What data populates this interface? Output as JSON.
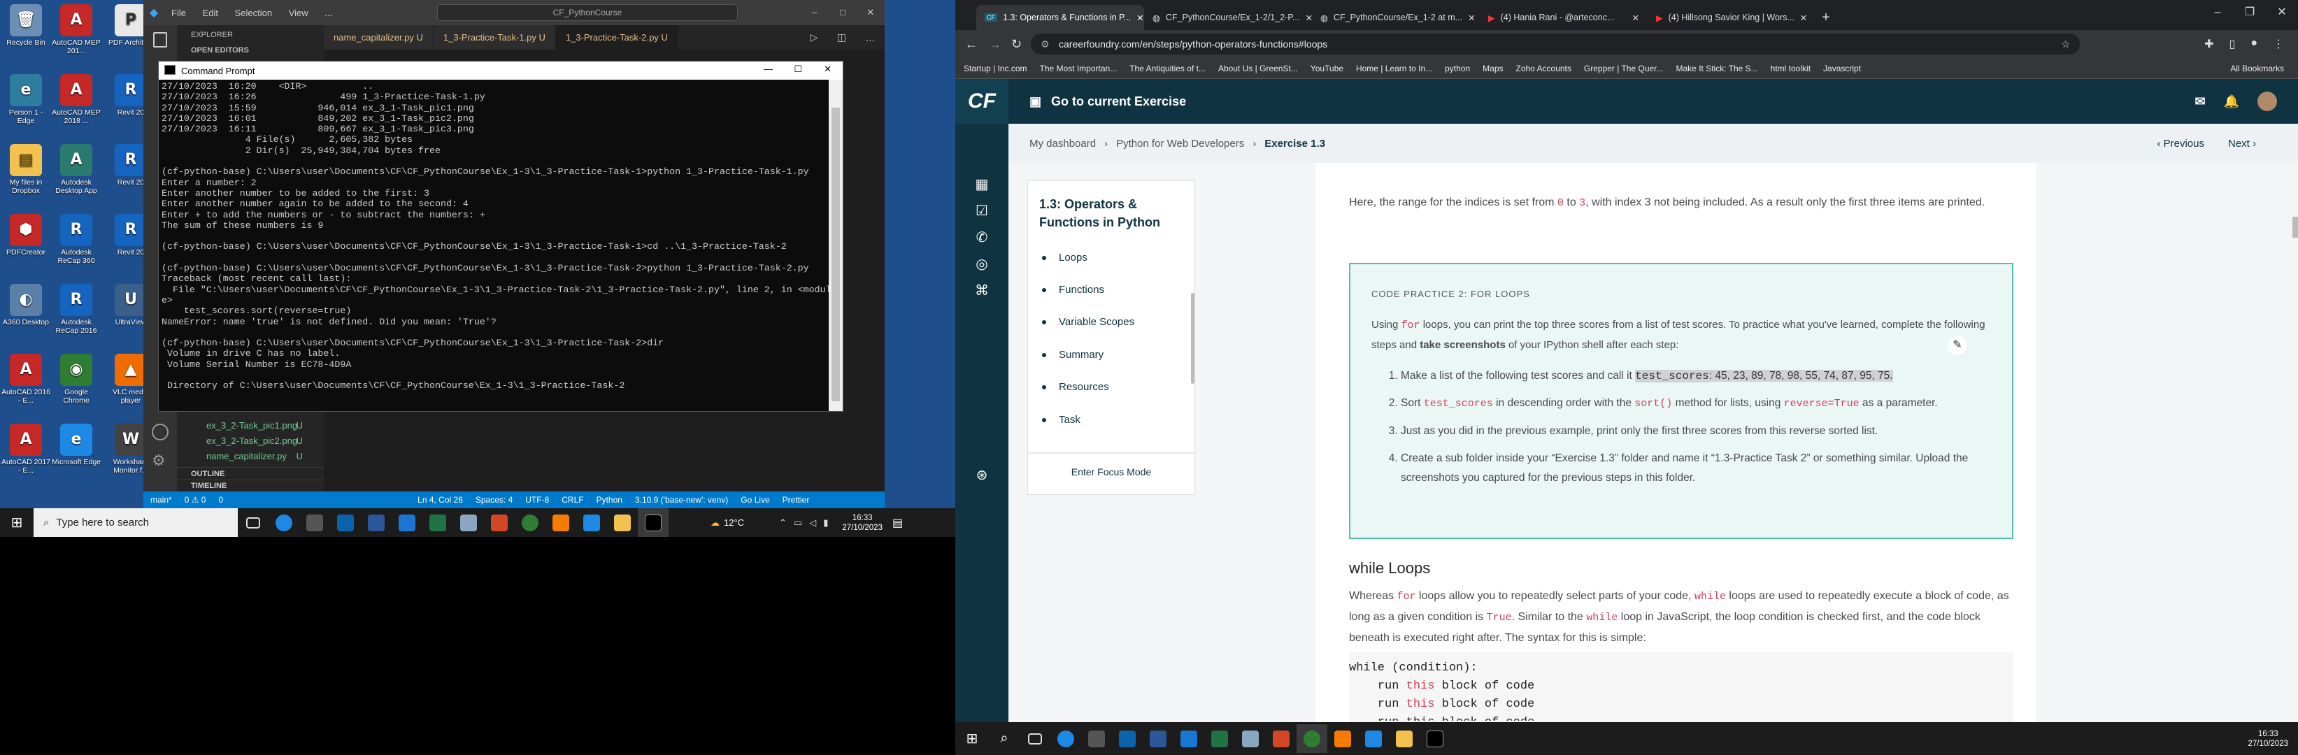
{
  "desktop": {
    "icons": [
      {
        "label": "Recycle Bin",
        "color": "#6d8fb5",
        "glyph": "🗑"
      },
      {
        "label": "AutoCAD MEP 201...",
        "color": "#c62828",
        "glyph": "A"
      },
      {
        "label": "PDF Architect",
        "color": "#e8e8e8",
        "glyph": "P"
      },
      {
        "label": "Person 1 - Edge",
        "color": "#2e7d9e",
        "glyph": "e"
      },
      {
        "label": "AutoCAD MEP 2018 ...",
        "color": "#c62828",
        "glyph": "A"
      },
      {
        "label": "Revit 20",
        "color": "#1565c0",
        "glyph": "R"
      },
      {
        "label": "My files in Dropbox",
        "color": "#f2c14e",
        "glyph": "▤"
      },
      {
        "label": "Autodesk Desktop App",
        "color": "#2a7a6e",
        "glyph": "A"
      },
      {
        "label": "Revit 20",
        "color": "#1565c0",
        "glyph": "R"
      },
      {
        "label": "PDFCreator",
        "color": "#c62828",
        "glyph": "⬢"
      },
      {
        "label": "Autodesk ReCap 360",
        "color": "#1565c0",
        "glyph": "R"
      },
      {
        "label": "Revit 20",
        "color": "#1565c0",
        "glyph": "R"
      },
      {
        "label": "A360 Desktop",
        "color": "#5a7fa8",
        "glyph": "◐"
      },
      {
        "label": "Autodesk ReCap 2016",
        "color": "#1565c0",
        "glyph": "R"
      },
      {
        "label": "UltraView",
        "color": "#3a5f8a",
        "glyph": "U"
      },
      {
        "label": "AutoCAD 2016 - E...",
        "color": "#c62828",
        "glyph": "A"
      },
      {
        "label": "Google Chrome",
        "color": "#2e7d32",
        "glyph": "◉"
      },
      {
        "label": "VLC media player",
        "color": "#ef6c00",
        "glyph": "▲"
      },
      {
        "label": "AutoCAD 2017 - E...",
        "color": "#c62828",
        "glyph": "A"
      },
      {
        "label": "Microsoft Edge",
        "color": "#1e88e5",
        "glyph": "e"
      },
      {
        "label": "Workshare Monitor f...",
        "color": "#424242",
        "glyph": "W"
      }
    ]
  },
  "vscode": {
    "menu": [
      "File",
      "Edit",
      "Selection",
      "View",
      "..."
    ],
    "search": "CF_PythonCourse",
    "tabs": [
      {
        "label": "name_capitalizer.py  U"
      },
      {
        "label": "1_3-Practice-Task-1.py  U"
      },
      {
        "label": "1_3-Practice-Task-2.py  U"
      }
    ],
    "sidebar_title": "EXPLORER",
    "sidebar_sub": "OPEN EDITORS",
    "files": [
      {
        "name": "ex_3_2-Task_pic1.png",
        "status": "U"
      },
      {
        "name": "ex_3_2-Task_pic2.png",
        "status": "U"
      },
      {
        "name": "name_capitalizer.py",
        "status": "U"
      }
    ],
    "sections": [
      "OUTLINE",
      "TIMELINE"
    ],
    "status": {
      "branch": "main*",
      "errors": "0 ⚠ 0",
      "ports": "0",
      "position": "Ln 4, Col 26",
      "spaces": "Spaces: 4",
      "encoding": "UTF-8",
      "eol": "CRLF",
      "language": "Python",
      "interpreter": "3.10.9 ('base-new': venv)",
      "golive": "Go Live",
      "prettier": "Prettier"
    }
  },
  "cmd": {
    "title": "Command Prompt",
    "lines": [
      "27/10/2023  16:20    <DIR>          ..",
      "27/10/2023  16:26               499 1_3-Practice-Task-1.py",
      "27/10/2023  15:59           946,014 ex_3_1-Task_pic1.png",
      "27/10/2023  16:01           849,202 ex_3_1-Task_pic2.png",
      "27/10/2023  16:11           809,667 ex_3_1-Task_pic3.png",
      "               4 File(s)      2,605,382 bytes",
      "               2 Dir(s)  25,949,384,704 bytes free",
      "",
      "(cf-python-base) C:\\Users\\user\\Documents\\CF\\CF_PythonCourse\\Ex_1-3\\1_3-Practice-Task-1>python 1_3-Practice-Task-1.py",
      "Enter a number: 2",
      "Enter another number to be added to the first: 3",
      "Enter another number again to be added to the second: 4",
      "Enter + to add the numbers or - to subtract the numbers: +",
      "The sum of these numbers is 9",
      "",
      "(cf-python-base) C:\\Users\\user\\Documents\\CF\\CF_PythonCourse\\Ex_1-3\\1_3-Practice-Task-1>cd ..\\1_3-Practice-Task-2",
      "",
      "(cf-python-base) C:\\Users\\user\\Documents\\CF\\CF_PythonCourse\\Ex_1-3\\1_3-Practice-Task-2>python 1_3-Practice-Task-2.py",
      "Traceback (most recent call last):",
      "  File \"C:\\Users\\user\\Documents\\CF\\CF_PythonCourse\\Ex_1-3\\1_3-Practice-Task-2\\1_3-Practice-Task-2.py\", line 2, in <modul",
      "e>",
      "    test_scores.sort(reverse=true)",
      "NameError: name 'true' is not defined. Did you mean: 'True'?",
      "",
      "(cf-python-base) C:\\Users\\user\\Documents\\CF\\CF_PythonCourse\\Ex_1-3\\1_3-Practice-Task-2>dir",
      " Volume in drive C has no label.",
      " Volume Serial Number is EC78-4D9A",
      "",
      " Directory of C:\\Users\\user\\Documents\\CF\\CF_PythonCourse\\Ex_1-3\\1_3-Practice-Task-2"
    ]
  },
  "taskbar_left": {
    "search_placeholder": "Type here to search",
    "weather": "12°C",
    "time": "16:33",
    "date": "27/10/2023"
  },
  "chrome": {
    "tabs": [
      {
        "label": "1.3: Operators & Functions in P...",
        "icon": "CF"
      },
      {
        "label": "CF_PythonCourse/Ex_1-2/1_2-P...",
        "icon": "gh"
      },
      {
        "label": "CF_PythonCourse/Ex_1-2 at m...",
        "icon": "gh"
      },
      {
        "label": "(4) Hania Rani - @arteconc...",
        "icon": "yt"
      },
      {
        "label": "(4) Hillsong Savior King | Wors...",
        "icon": "yt"
      }
    ],
    "url": "careerfoundry.com/en/steps/python-operators-functions#loops",
    "bookmarks": [
      "Startup | Inc.com",
      "The Most Importan...",
      "The Antiquities of t...",
      "About Us | GreenSt...",
      "YouTube",
      "Home | Learn to In...",
      "python",
      "Maps",
      "Zoho Accounts",
      "Grepper | The Quer...",
      "Make It Stick: The S...",
      "html toolkit",
      "Javascript",
      "All Bookmarks"
    ]
  },
  "cf": {
    "logo": "CF",
    "top_title": "Go to current Exercise",
    "breadcrumb": [
      "My dashboard",
      "Python for Web Developers",
      "Exercise 1.3"
    ],
    "prev": "Previous",
    "next": "Next",
    "toc_title": "1.3: Operators & Functions in Python",
    "toc_items": [
      "Loops",
      "Functions",
      "Variable Scopes",
      "Summary",
      "Resources",
      "Task"
    ],
    "focus_mode": "Enter Focus Mode",
    "intro_1": "Here, the range for the indices is set from ",
    "intro_code1": "0",
    "intro_2": " to ",
    "intro_code2": "3",
    "intro_3": ", with index 3 not being included. As a result only the first three items are printed.",
    "practice_title": "CODE PRACTICE 2: FOR LOOPS",
    "practice_intro_a": "Using ",
    "practice_intro_code": "for",
    "practice_intro_b": " loops, you can print the top three scores from a list of test scores. To practice what you've learned, complete the following steps and ",
    "practice_intro_bold": "take screenshots",
    "practice_intro_c": " of your IPython shell after each step:",
    "steps": {
      "s1a": "Make a list of the following test scores and call it ",
      "s1code": "test_scores",
      "s1b": ": 45, 23, 89, 78, 98, 55, 74, 87, 95, 75.",
      "s2a": "Sort ",
      "s2code1": "test_scores",
      "s2b": " in descending order with the ",
      "s2code2": "sort()",
      "s2c": " method for lists, using ",
      "s2code3": "reverse=True",
      "s2d": " as a parameter.",
      "s3": "Just as you did in the previous example, print only the first three scores from this reverse sorted list.",
      "s4": "Create a sub folder inside your “Exercise 1.3” folder and name it “1.3-Practice Task 2” or something similar. Upload the screenshots you captured for the previous steps in this folder."
    },
    "while_title": "while Loops",
    "while_a": "Whereas ",
    "while_code1": "for",
    "while_b": " loops allow you to repeatedly select parts of your code, ",
    "while_code2": "while",
    "while_c": " loops are used to repeatedly execute a block of code, as long as a given condition is ",
    "while_code3": "True",
    "while_d": ". Similar to the ",
    "while_code4": "while",
    "while_e": " loop in JavaScript, the loop condition is checked first, and the code block beneath is executed right after. The syntax for this is simple:",
    "code": {
      "l1a": "while",
      "l1b": " (condition):",
      "l2a": "    run ",
      "l2b": "this",
      "l2c": " block of code",
      "l3a": "    run ",
      "l3b": "this",
      "l3c": " block of code",
      "l4": "    run this block of code"
    }
  },
  "taskbar_right": {
    "time": "16:33",
    "date": "27/10/2023"
  }
}
